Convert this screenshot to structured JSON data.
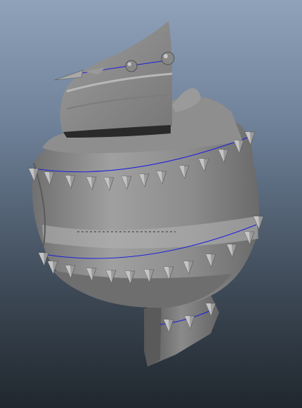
{
  "viewport": {
    "background_top": "#8fa2ba",
    "background_bottom": "#20272e"
  },
  "model": {
    "shade_light": "#a7a7a7",
    "shade_mid": "#8b8b8b",
    "shade_dark": "#4a4a4a",
    "edge_highlight": "#1d1de0"
  }
}
